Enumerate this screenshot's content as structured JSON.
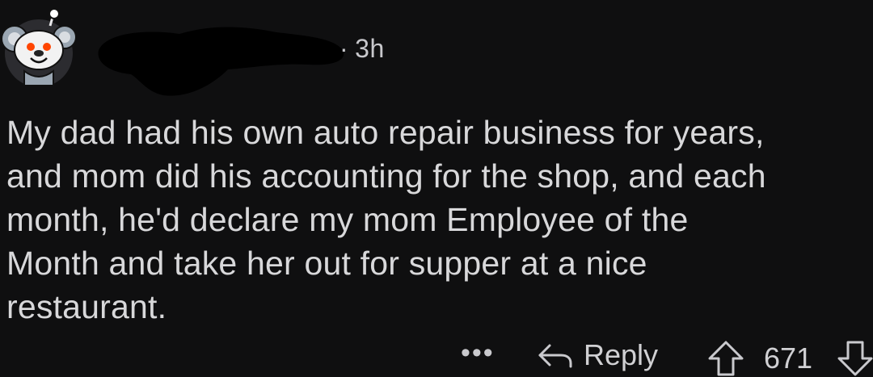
{
  "comment": {
    "timestamp_separator": "·",
    "timestamp": "3h",
    "body_lines": [
      "My dad had his own auto repair business for years,",
      "and mom did his accounting for the shop, and each",
      "month, he'd declare my mom Employee of the",
      "Month and take her out for supper at a nice",
      "restaurant."
    ]
  },
  "actions": {
    "more_label": "•••",
    "reply_label": "Reply",
    "score": "671"
  },
  "icons": {
    "avatar": "snoo-avatar-icon",
    "more": "more-options-icon",
    "reply": "reply-arrow-icon",
    "upvote": "upvote-arrow-icon",
    "downvote": "downvote-arrow-icon"
  },
  "colors": {
    "background": "#0f0f10",
    "text": "#d8d8da",
    "avatar_circle": "#2c2c30",
    "avatar_accent": "#ff4500"
  }
}
